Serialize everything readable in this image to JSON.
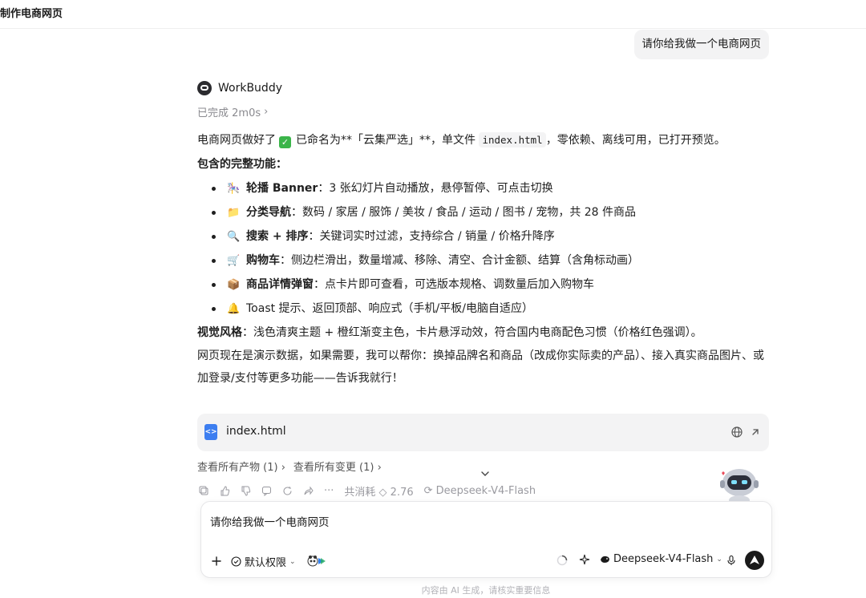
{
  "header": {
    "title": "制作电商网页"
  },
  "user_message": "请你给我做一个电商网页",
  "assistant": {
    "name": "WorkBuddy",
    "status": "已完成 2m0s",
    "intro": {
      "before": "电商网页做好了",
      "middle": "已命名为**「云集严选」**，单文件",
      "code": "index.html",
      "after": "，零依赖、离线可用，已打开预览。"
    },
    "features_title": "包含的完整功能：",
    "features": [
      {
        "icon": "carousel-icon",
        "glyph": "🎠",
        "title": "轮播 Banner",
        "desc": "：3 张幻灯片自动播放，悬停暂停、可点击切换"
      },
      {
        "icon": "folder-icon",
        "glyph": "📁",
        "title": "分类导航",
        "desc": "：数码 / 家居 / 服饰 / 美妆 / 食品 / 运动 / 图书 / 宠物，共 28 件商品"
      },
      {
        "icon": "magnifier-icon",
        "glyph": "🔍",
        "title": "搜索 + 排序",
        "desc": "：关键词实时过滤，支持综合 / 销量 / 价格升降序"
      },
      {
        "icon": "cart-icon",
        "glyph": "🛒",
        "title": "购物车",
        "desc": "：侧边栏滑出，数量增减、移除、清空、合计金额、结算（含角标动画）"
      },
      {
        "icon": "package-icon",
        "glyph": "📦",
        "title": "商品详情弹窗",
        "desc": "：点卡片即可查看，可选版本规格、调数量后加入购物车"
      },
      {
        "icon": "bell-icon",
        "glyph": "🔔",
        "title": "",
        "desc": "Toast 提示、返回顶部、响应式（手机/平板/电脑自适应）"
      }
    ],
    "style_title": "视觉风格",
    "style_desc": "：浅色清爽主题 + 橙红渐变主色，卡片悬浮动效，符合国内电商配色习惯（价格红色强调）。",
    "help_text": "网页现在是演示数据，如果需要，我可以帮你：换掉品牌名和商品（改成你实际卖的产品）、接入真实商品图片、或加登录/支付等更多功能——告诉我就行！"
  },
  "file_card": {
    "name": "index.html"
  },
  "links": {
    "artifacts": "查看所有产物 (1)",
    "changes": "查看所有变更 (1)"
  },
  "action_bar": {
    "cost": "共消耗 ◇ 2.76",
    "model": "Deepseek-V4-Flash"
  },
  "input": {
    "value": "请你给我做一个电商网页",
    "permission_label": "默认权限",
    "model_label": "Deepseek-V4-Flash"
  },
  "footer_note": "内容由 AI 生成，请核实重要信息",
  "colors": {
    "accent_green": "#3bb54a",
    "file_blue": "#3d7ef0",
    "send_black": "#1a1a1a"
  }
}
